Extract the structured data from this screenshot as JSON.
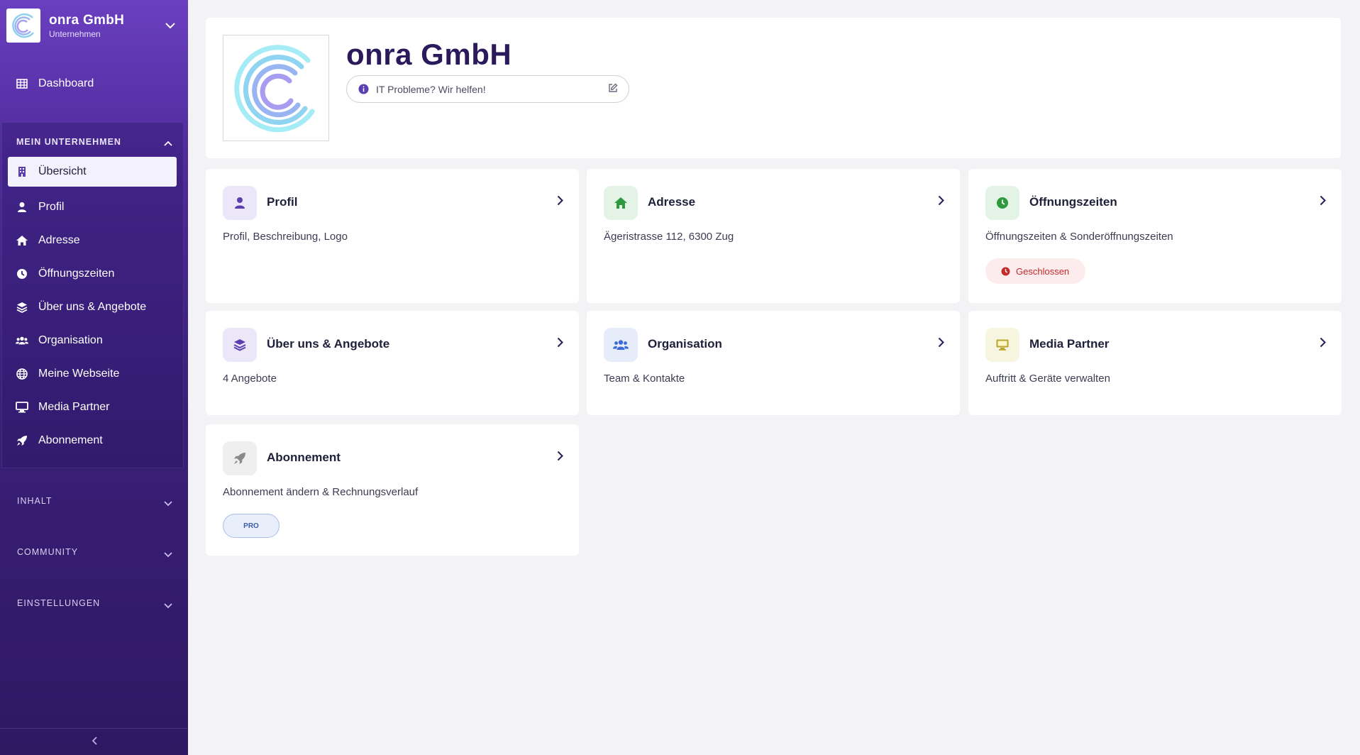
{
  "org": {
    "name": "onra GmbH",
    "subtitle": "Unternehmen"
  },
  "nav": {
    "dashboard": "Dashboard",
    "group_title": "MEIN UNTERNEHMEN",
    "items": [
      {
        "label": "Übersicht",
        "icon": "building-icon",
        "active": true
      },
      {
        "label": "Profil",
        "icon": "user-icon"
      },
      {
        "label": "Adresse",
        "icon": "home-icon"
      },
      {
        "label": "Öffnungszeiten",
        "icon": "clock-icon"
      },
      {
        "label": "Über uns & Angebote",
        "icon": "layers-icon"
      },
      {
        "label": "Organisation",
        "icon": "users-icon"
      },
      {
        "label": "Meine Webseite",
        "icon": "globe-icon"
      },
      {
        "label": "Media Partner",
        "icon": "monitor-icon"
      },
      {
        "label": "Abonnement",
        "icon": "rocket-icon"
      }
    ],
    "sections": [
      "INHALT",
      "COMMUNITY",
      "EINSTELLUNGEN"
    ]
  },
  "header": {
    "title": "onra GmbH",
    "tagline": "IT Probleme? Wir helfen!"
  },
  "cards": {
    "profil": {
      "title": "Profil",
      "desc": "Profil, Beschreibung, Logo"
    },
    "adresse": {
      "title": "Adresse",
      "desc": "Ägeristrasse 112, 6300 Zug"
    },
    "oeffnung": {
      "title": "Öffnungszeiten",
      "desc": "Öffnungszeiten & Sonderöffnungszeiten",
      "badge": "Geschlossen"
    },
    "ueber": {
      "title": "Über uns & Angebote",
      "desc": "4 Angebote"
    },
    "organisation": {
      "title": "Organisation",
      "desc": "Team & Kontakte"
    },
    "media": {
      "title": "Media Partner",
      "desc": "Auftritt & Geräte verwalten"
    },
    "abo": {
      "title": "Abonnement",
      "desc": "Abonnement ändern & Rechnungsverlauf",
      "badge": "PRO"
    }
  },
  "colors": {
    "sidebar_top": "#6a3fc0",
    "sidebar_bottom": "#2e1862",
    "accent": "#5b3fb0",
    "closed": "#c42a2a"
  }
}
